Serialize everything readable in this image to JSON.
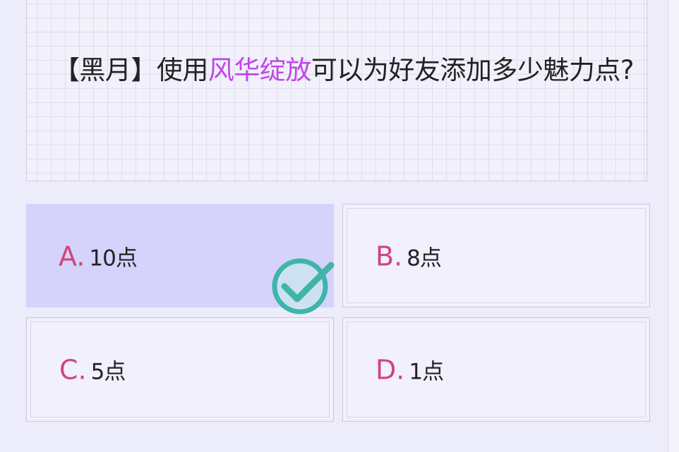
{
  "question": {
    "prefix": "【黑月】使用",
    "highlight": "风华绽放",
    "suffix": "可以为好友添加多少魅力点?"
  },
  "options": [
    {
      "letter": "A.",
      "text": "10点",
      "selected": true
    },
    {
      "letter": "B.",
      "text": "8点",
      "selected": false
    },
    {
      "letter": "C.",
      "text": "5点",
      "selected": false
    },
    {
      "letter": "D.",
      "text": "1点",
      "selected": false
    }
  ],
  "colors": {
    "highlight": "#c046e8",
    "letter": "#d0457a",
    "selected_bg": "#d5d2fb",
    "check": "#3fb5a9"
  },
  "icons": {
    "correct": "check-circle-icon"
  }
}
